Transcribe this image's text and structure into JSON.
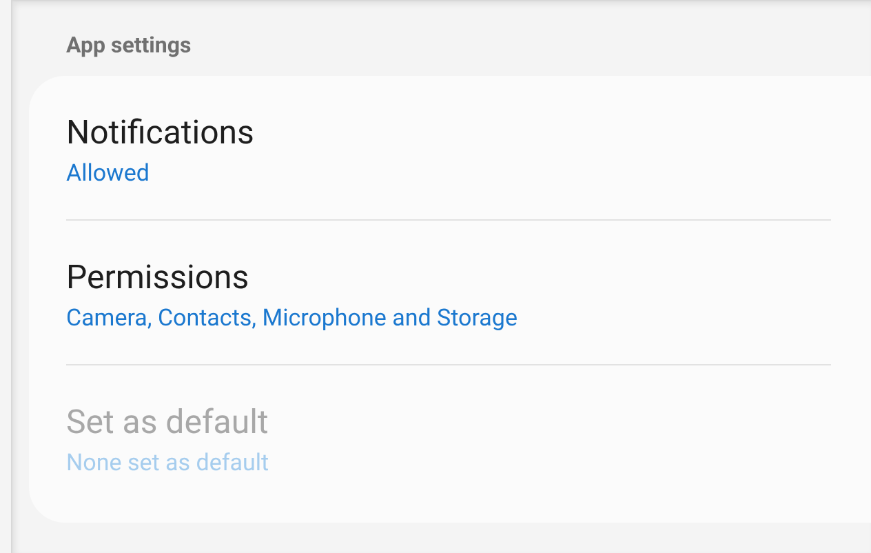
{
  "section_header": "App settings",
  "items": [
    {
      "title": "Notifications",
      "summary": "Allowed",
      "disabled": false
    },
    {
      "title": "Permissions",
      "summary": "Camera, Contacts, Microphone and Storage",
      "disabled": false
    },
    {
      "title": "Set as default",
      "summary": "None set as default",
      "disabled": true
    }
  ]
}
